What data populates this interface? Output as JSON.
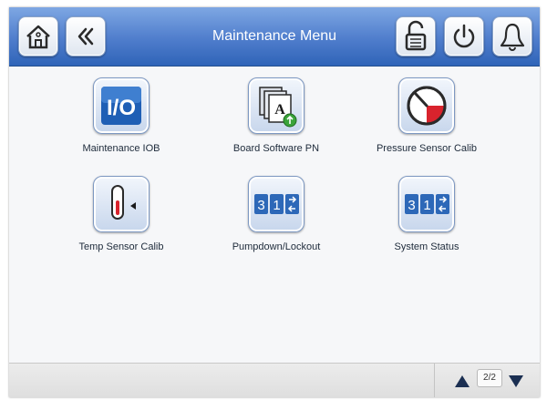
{
  "header": {
    "title": "Maintenance Menu",
    "home_icon": "home-icon",
    "back_icon": "back-chevron-icon",
    "lock_icon": "unlocked-padlock-icon",
    "power_icon": "power-icon",
    "alarm_icon": "bell-icon"
  },
  "menu": {
    "items": [
      {
        "label": "Maintenance IOB",
        "tile_text": "I/O",
        "icon": "io-icon"
      },
      {
        "label": "Board Software PN",
        "tile_text": "A",
        "icon": "documents-icon"
      },
      {
        "label": "Pressure Sensor Calib",
        "icon": "gauge-icon"
      },
      {
        "label": "Temp Sensor Calib",
        "icon": "thermometer-icon"
      },
      {
        "label": "Pumpdown/Lockout",
        "tile_text_1": "3",
        "tile_text_2": "1",
        "icon": "counter-icon"
      },
      {
        "label": "System Status",
        "tile_text_1": "3",
        "tile_text_2": "1",
        "icon": "counter-icon"
      }
    ]
  },
  "pager": {
    "page": "2/2"
  },
  "colors": {
    "header": "#4f7dcc",
    "gauge_red": "#d9232d",
    "io_blue": "#1f5fb5"
  }
}
